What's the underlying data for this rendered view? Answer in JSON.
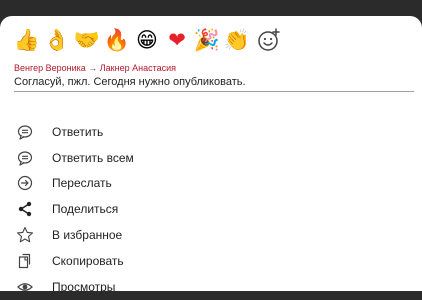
{
  "reactions": [
    {
      "icon": "thumbs-up",
      "glyph": "👍"
    },
    {
      "icon": "ok-hand",
      "glyph": "👌"
    },
    {
      "icon": "handshake",
      "glyph": "🤝"
    },
    {
      "icon": "fire",
      "glyph": "🔥"
    },
    {
      "icon": "grinning-face",
      "glyph": "😁"
    },
    {
      "icon": "red-heart",
      "glyph": "❤"
    },
    {
      "icon": "party-popper",
      "glyph": "🎉"
    },
    {
      "icon": "clapping-hands",
      "glyph": "👏"
    }
  ],
  "quote": {
    "from": "Венгер Вероника",
    "arrow": "→",
    "to": "Лакнер Анастасия",
    "text": "Согласуй, пжл. Сегодня нужно опубликовать."
  },
  "menu": [
    {
      "icon": "chat-bubble-icon",
      "label": "Ответить"
    },
    {
      "icon": "chat-bubble-icon",
      "label": "Ответить всем"
    },
    {
      "icon": "forward-arrow-icon",
      "label": "Переслать"
    },
    {
      "icon": "share-icon",
      "label": "Поделиться"
    },
    {
      "icon": "star-outline-icon",
      "label": "В избранное"
    },
    {
      "icon": "copy-icon",
      "label": "Скопировать"
    },
    {
      "icon": "eye-icon",
      "label": "Просмотры"
    }
  ],
  "colors": {
    "sender": "#b2182b",
    "text": "#1f1f1f",
    "background_top": "#2b2b2b"
  }
}
